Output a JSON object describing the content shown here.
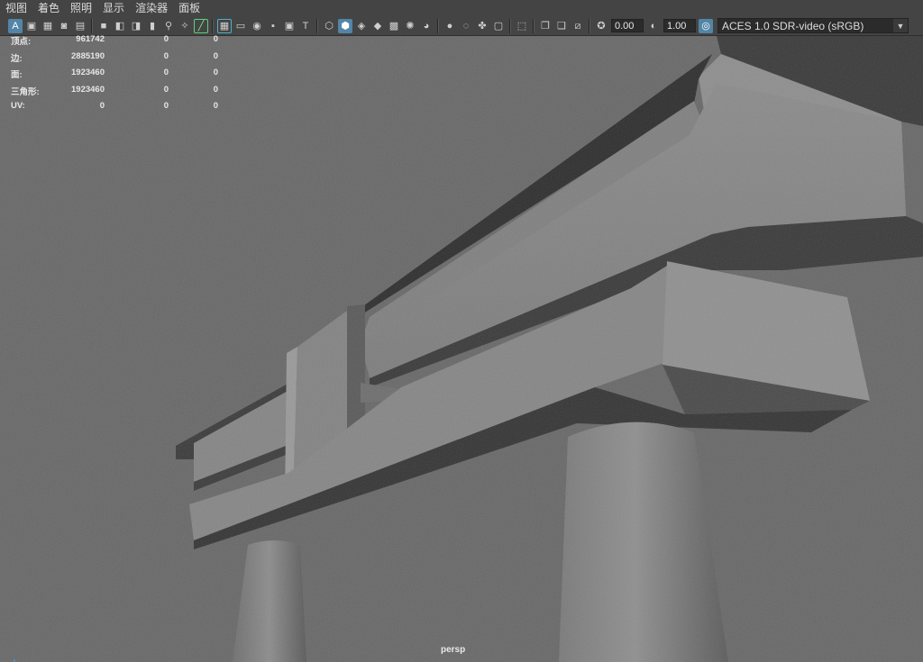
{
  "menubar": {
    "items": [
      "视图",
      "着色",
      "照明",
      "显示",
      "渲染器",
      "面板"
    ]
  },
  "toolbar": {
    "icons": [
      "select-camera-icon",
      "camera-attributes-icon",
      "bookmark-icon",
      "image-plane-icon",
      "grease-pencil-icon",
      "camera-icon",
      "camera-lock-icon",
      "camera-sync-icon",
      "pin-icon",
      "pan-zoom-icon",
      "2d-pan-icon",
      "grid-icon",
      "film-gate-icon",
      "resolution-gate-icon",
      "gate-mask-icon",
      "field-chart-icon",
      "safe-title-icon",
      "wireframe-icon",
      "smooth-shade-icon",
      "wireframe-on-shaded-icon",
      "xray-icon",
      "use-default-material-icon",
      "lights-icon",
      "shadows-icon",
      "ambient-occlusion-icon",
      "motion-blur-icon",
      "anti-alias-icon",
      "depth-of-field-icon",
      "isolate-select-icon",
      "xray-active-icon",
      "xray-joints-icon",
      "backface-culling-icon",
      "exposure-icon",
      "gamma-icon",
      "color-management-icon"
    ],
    "exposure_value": "0.00",
    "gamma_value": "1.00",
    "color_space": "ACES 1.0 SDR-video (sRGB)"
  },
  "hud": {
    "rows": [
      {
        "label": "顶点:",
        "v1": "961742",
        "v2": "0",
        "v3": "0"
      },
      {
        "label": "边:",
        "v1": "2885190",
        "v2": "0",
        "v3": "0"
      },
      {
        "label": "面:",
        "v1": "1923460",
        "v2": "0",
        "v3": "0"
      },
      {
        "label": "三角形:",
        "v1": "1923460",
        "v2": "0",
        "v3": "0"
      },
      {
        "label": "UV:",
        "v1": "0",
        "v2": "0",
        "v3": "0"
      }
    ]
  },
  "viewport": {
    "camera_label": "persp",
    "background_color": "#686868",
    "model_color": "#8a8a8a"
  },
  "colors": {
    "ui_bg": "#444444",
    "field_bg": "#2b2b2b",
    "active_blue": "#5285a6"
  }
}
